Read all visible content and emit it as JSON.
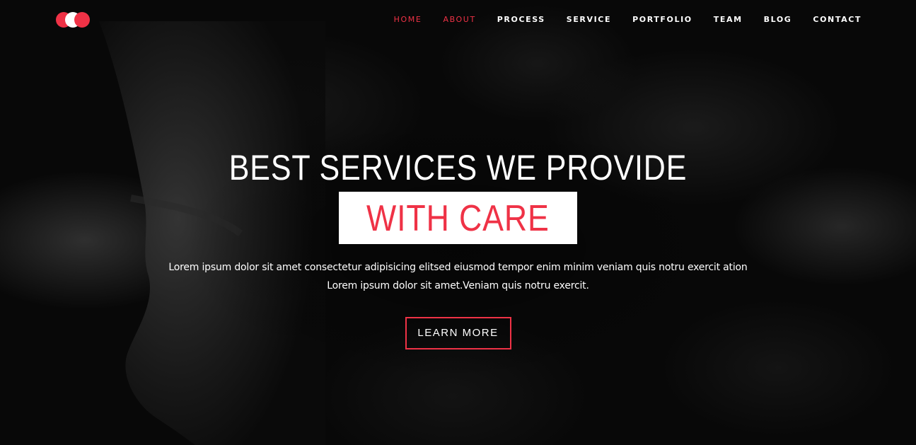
{
  "header": {
    "nav": [
      {
        "label": "HOME",
        "active": true
      },
      {
        "label": "ABOUT",
        "active": true
      },
      {
        "label": "PROCESS",
        "active": false
      },
      {
        "label": "SERVICE",
        "active": false
      },
      {
        "label": "PORTFOLIO",
        "active": false
      },
      {
        "label": "TEAM",
        "active": false
      },
      {
        "label": "BLOG",
        "active": false
      },
      {
        "label": "CONTACT",
        "active": false
      }
    ]
  },
  "hero": {
    "headline": "BEST SERVICES WE PROVIDE",
    "highlight": "WITH CARE",
    "description_line1": "Lorem ipsum dolor sit amet consectetur adipisicing elitsed eiusmod tempor enim minim veniam quis notru exercit ation",
    "description_line2": "Lorem ipsum dolor sit amet.Veniam quis notru exercit.",
    "button_label": "LEARN MORE"
  },
  "colors": {
    "accent": "#ef3246",
    "text": "#ffffff",
    "background": "#080808"
  }
}
